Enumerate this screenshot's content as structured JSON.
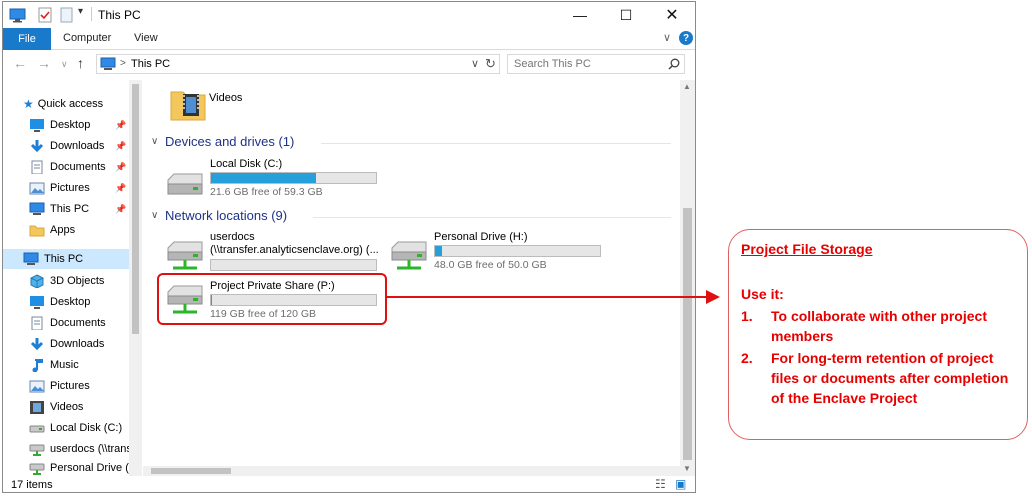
{
  "window": {
    "title": "This PC",
    "tabs": [
      "File",
      "Computer",
      "View"
    ],
    "help_label": "?"
  },
  "address": {
    "breadcrumb_sep": ">",
    "location": "This PC"
  },
  "search": {
    "placeholder": "Search This PC"
  },
  "nav": {
    "items": [
      {
        "label": "Quick access",
        "icon": "star-icon"
      },
      {
        "label": "Desktop",
        "icon": "desktop-icon",
        "pinned": true
      },
      {
        "label": "Downloads",
        "icon": "download-arrow-icon",
        "pinned": true
      },
      {
        "label": "Documents",
        "icon": "document-icon",
        "pinned": true
      },
      {
        "label": "Pictures",
        "icon": "pictures-icon",
        "pinned": true
      },
      {
        "label": "This PC",
        "icon": "monitor-icon",
        "pinned": true
      },
      {
        "label": "Apps",
        "icon": "folder-icon"
      },
      {
        "label": "This PC",
        "icon": "monitor-icon",
        "selected": true
      },
      {
        "label": "3D Objects",
        "icon": "cube-icon"
      },
      {
        "label": "Desktop",
        "icon": "desktop-icon"
      },
      {
        "label": "Documents",
        "icon": "document-icon"
      },
      {
        "label": "Downloads",
        "icon": "download-arrow-icon"
      },
      {
        "label": "Music",
        "icon": "music-note-icon"
      },
      {
        "label": "Pictures",
        "icon": "pictures-icon"
      },
      {
        "label": "Videos",
        "icon": "film-icon"
      },
      {
        "label": "Local Disk (C:)",
        "icon": "disk-icon"
      },
      {
        "label": "userdocs (\\\\trans",
        "icon": "network-drive-icon"
      },
      {
        "label": "Personal Drive (H",
        "icon": "network-drive-icon"
      }
    ]
  },
  "content": {
    "videos_label": "Videos",
    "devices_group": "Devices and drives (1)",
    "network_group": "Network locations (9)",
    "drives": {
      "c": {
        "name": "Local Disk (C:)",
        "free": "21.6 GB free of 59.3 GB",
        "used_fraction": 0.636
      },
      "userdocs": {
        "name1": "userdocs",
        "name2": "(\\\\transfer.analyticsenclave.org) (...",
        "used_fraction": 0.0
      },
      "h": {
        "name": "Personal Drive (H:)",
        "free": "48.0 GB free of 50.0 GB",
        "used_fraction": 0.04
      },
      "p": {
        "name": "Project Private Share (P:)",
        "free": "119 GB free of 120 GB",
        "used_fraction": 0.008
      }
    }
  },
  "status": {
    "items": "17 items"
  },
  "callout": {
    "heading": "Project File Storage",
    "use_it": "Use it:",
    "points": [
      {
        "num": "1.",
        "text": "To collaborate with other project members"
      },
      {
        "num": "2.",
        "text": "For long-term retention of project files or documents after completion of the Enclave Project"
      }
    ]
  },
  "colors": {
    "accent": "#1979ca",
    "drive_fill": "#26a0da",
    "annotation": "#e01010",
    "selection": "#cce8ff"
  }
}
